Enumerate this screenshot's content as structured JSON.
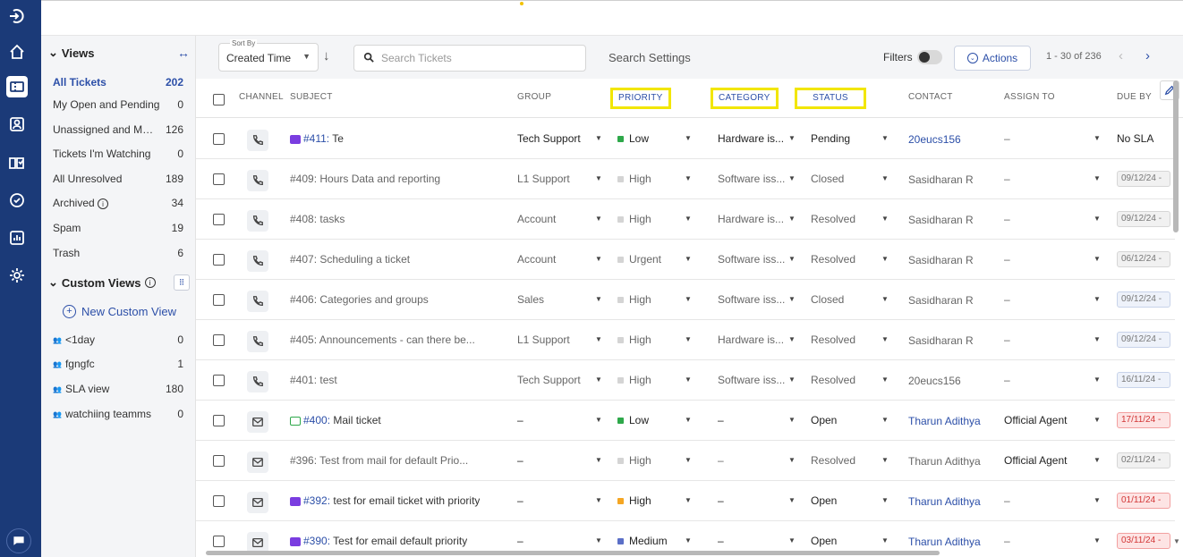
{
  "rail": {
    "icons": [
      "logout-icon",
      "home-icon",
      "tickets-icon",
      "contacts-icon",
      "knowledge-base-icon",
      "tasks-icon",
      "reports-icon",
      "settings-icon"
    ],
    "chat_icon": "chat-icon"
  },
  "views": {
    "title": "Views",
    "items": [
      {
        "label": "All Tickets",
        "count": "202"
      },
      {
        "label": "My Open and Pending",
        "count": "0"
      },
      {
        "label": "Unassigned and My Open",
        "count": "126"
      },
      {
        "label": "Tickets I'm Watching",
        "count": "0"
      },
      {
        "label": "All Unresolved",
        "count": "189"
      },
      {
        "label": "Archived",
        "count": "34"
      },
      {
        "label": "Spam",
        "count": "19"
      },
      {
        "label": "Trash",
        "count": "6"
      }
    ],
    "custom_title": "Custom Views",
    "new_custom_view": "New Custom View",
    "custom_items": [
      {
        "label": "<1day",
        "count": "0"
      },
      {
        "label": "fgngfc",
        "count": "1"
      },
      {
        "label": "SLA view",
        "count": "180"
      },
      {
        "label": "watchiing teamms",
        "count": "0"
      }
    ]
  },
  "toolbar": {
    "sort_caption": "Sort By",
    "sort_value": "Created Time",
    "search_placeholder": "Search Tickets",
    "search_settings": "Search Settings",
    "filters": "Filters",
    "actions": "Actions",
    "pagination": "1 - 30 of 236"
  },
  "table": {
    "headers": {
      "channel": "CHANNEL",
      "subject": "SUBJECT",
      "group": "GROUP",
      "priority": "PRIORITY",
      "category": "CATEGORY",
      "status": "STATUS",
      "contact": "CONTACT",
      "assign": "ASSIGN TO",
      "due": "DUE BY"
    },
    "rows": [
      {
        "channel": "phone",
        "tag": "purple",
        "num": "#411:",
        "title": " Te",
        "subject_style": "new",
        "group": "Tech Support",
        "priority": "Low",
        "pcolor": "#2ea84a",
        "category": "Hardware is...",
        "status": "Pending",
        "contact": "20eucs156",
        "contact_link": true,
        "assign": "–",
        "due": "No SLA",
        "due_style": "plain"
      },
      {
        "channel": "phone",
        "tag": "",
        "num": "",
        "title": "#409: Hours Data and reporting",
        "subject_style": "old",
        "group": "L1 Support",
        "priority": "High",
        "pcolor": "#d4d4d4",
        "category": "Software iss...",
        "status": "Closed",
        "contact": "Sasidharan R",
        "contact_link": false,
        "assign": "–",
        "due": "09/12/24 -",
        "due_style": "grey"
      },
      {
        "channel": "phone",
        "tag": "",
        "num": "",
        "title": "#408: tasks",
        "subject_style": "old",
        "group": "Account",
        "priority": "High",
        "pcolor": "#d4d4d4",
        "category": "Hardware is...",
        "status": "Resolved",
        "contact": "Sasidharan R",
        "contact_link": false,
        "assign": "–",
        "due": "09/12/24 -",
        "due_style": "grey"
      },
      {
        "channel": "phone",
        "tag": "",
        "num": "",
        "title": "#407: Scheduling a ticket",
        "subject_style": "old",
        "group": "Account",
        "priority": "Urgent",
        "pcolor": "#d4d4d4",
        "category": "Software iss...",
        "status": "Resolved",
        "contact": "Sasidharan R",
        "contact_link": false,
        "assign": "–",
        "due": "06/12/24 -",
        "due_style": "grey"
      },
      {
        "channel": "phone",
        "tag": "",
        "num": "",
        "title": "#406: Categories and groups",
        "subject_style": "old",
        "group": "Sales",
        "priority": "High",
        "pcolor": "#d4d4d4",
        "category": "Software iss...",
        "status": "Closed",
        "contact": "Sasidharan R",
        "contact_link": false,
        "assign": "–",
        "due": "09/12/24 -",
        "due_style": "blue"
      },
      {
        "channel": "phone",
        "tag": "",
        "num": "",
        "title": "#405: Announcements - can there be...",
        "subject_style": "old",
        "group": "L1 Support",
        "priority": "High",
        "pcolor": "#d4d4d4",
        "category": "Hardware is...",
        "status": "Resolved",
        "contact": "Sasidharan R",
        "contact_link": false,
        "assign": "–",
        "due": "09/12/24 -",
        "due_style": "blue"
      },
      {
        "channel": "phone",
        "tag": "",
        "num": "",
        "title": "#401: test",
        "subject_style": "old",
        "group": "Tech Support",
        "priority": "High",
        "pcolor": "#d4d4d4",
        "category": "Software iss...",
        "status": "Resolved",
        "contact": "20eucs156",
        "contact_link": false,
        "assign": "–",
        "due": "16/11/24 -",
        "due_style": "blue"
      },
      {
        "channel": "mail",
        "tag": "green",
        "num": "#400:",
        "title": " Mail ticket",
        "subject_style": "new",
        "group": "–",
        "priority": "Low",
        "pcolor": "#2ea84a",
        "category": "–",
        "status": "Open",
        "contact": "Tharun Adithya",
        "contact_link": true,
        "assign": "Official Agent",
        "due": "17/11/24 -",
        "due_style": "red"
      },
      {
        "channel": "mail",
        "tag": "",
        "num": "",
        "title": "#396: Test from mail for default Prio...",
        "subject_style": "old",
        "group": "–",
        "priority": "High",
        "pcolor": "#d4d4d4",
        "category": "–",
        "status": "Resolved",
        "contact": "Tharun Adithya",
        "contact_link": false,
        "assign": "Official Agent",
        "due": "02/11/24 -",
        "due_style": "grey"
      },
      {
        "channel": "mail",
        "tag": "purple",
        "num": "#392:",
        "title": " test for email ticket with priority",
        "subject_style": "new",
        "group": "–",
        "priority": "High",
        "pcolor": "#f5a623",
        "category": "–",
        "status": "Open",
        "contact": "Tharun Adithya",
        "contact_link": true,
        "assign": "–",
        "due": "01/11/24 -",
        "due_style": "red"
      },
      {
        "channel": "mail",
        "tag": "purple",
        "num": "#390:",
        "title": " Test for email default priority",
        "subject_style": "new",
        "group": "–",
        "priority": "Medium",
        "pcolor": "#5b6fc7",
        "category": "–",
        "status": "Open",
        "contact": "Tharun Adithya",
        "contact_link": true,
        "assign": "–",
        "due": "03/11/24 -",
        "due_style": "red"
      }
    ]
  }
}
